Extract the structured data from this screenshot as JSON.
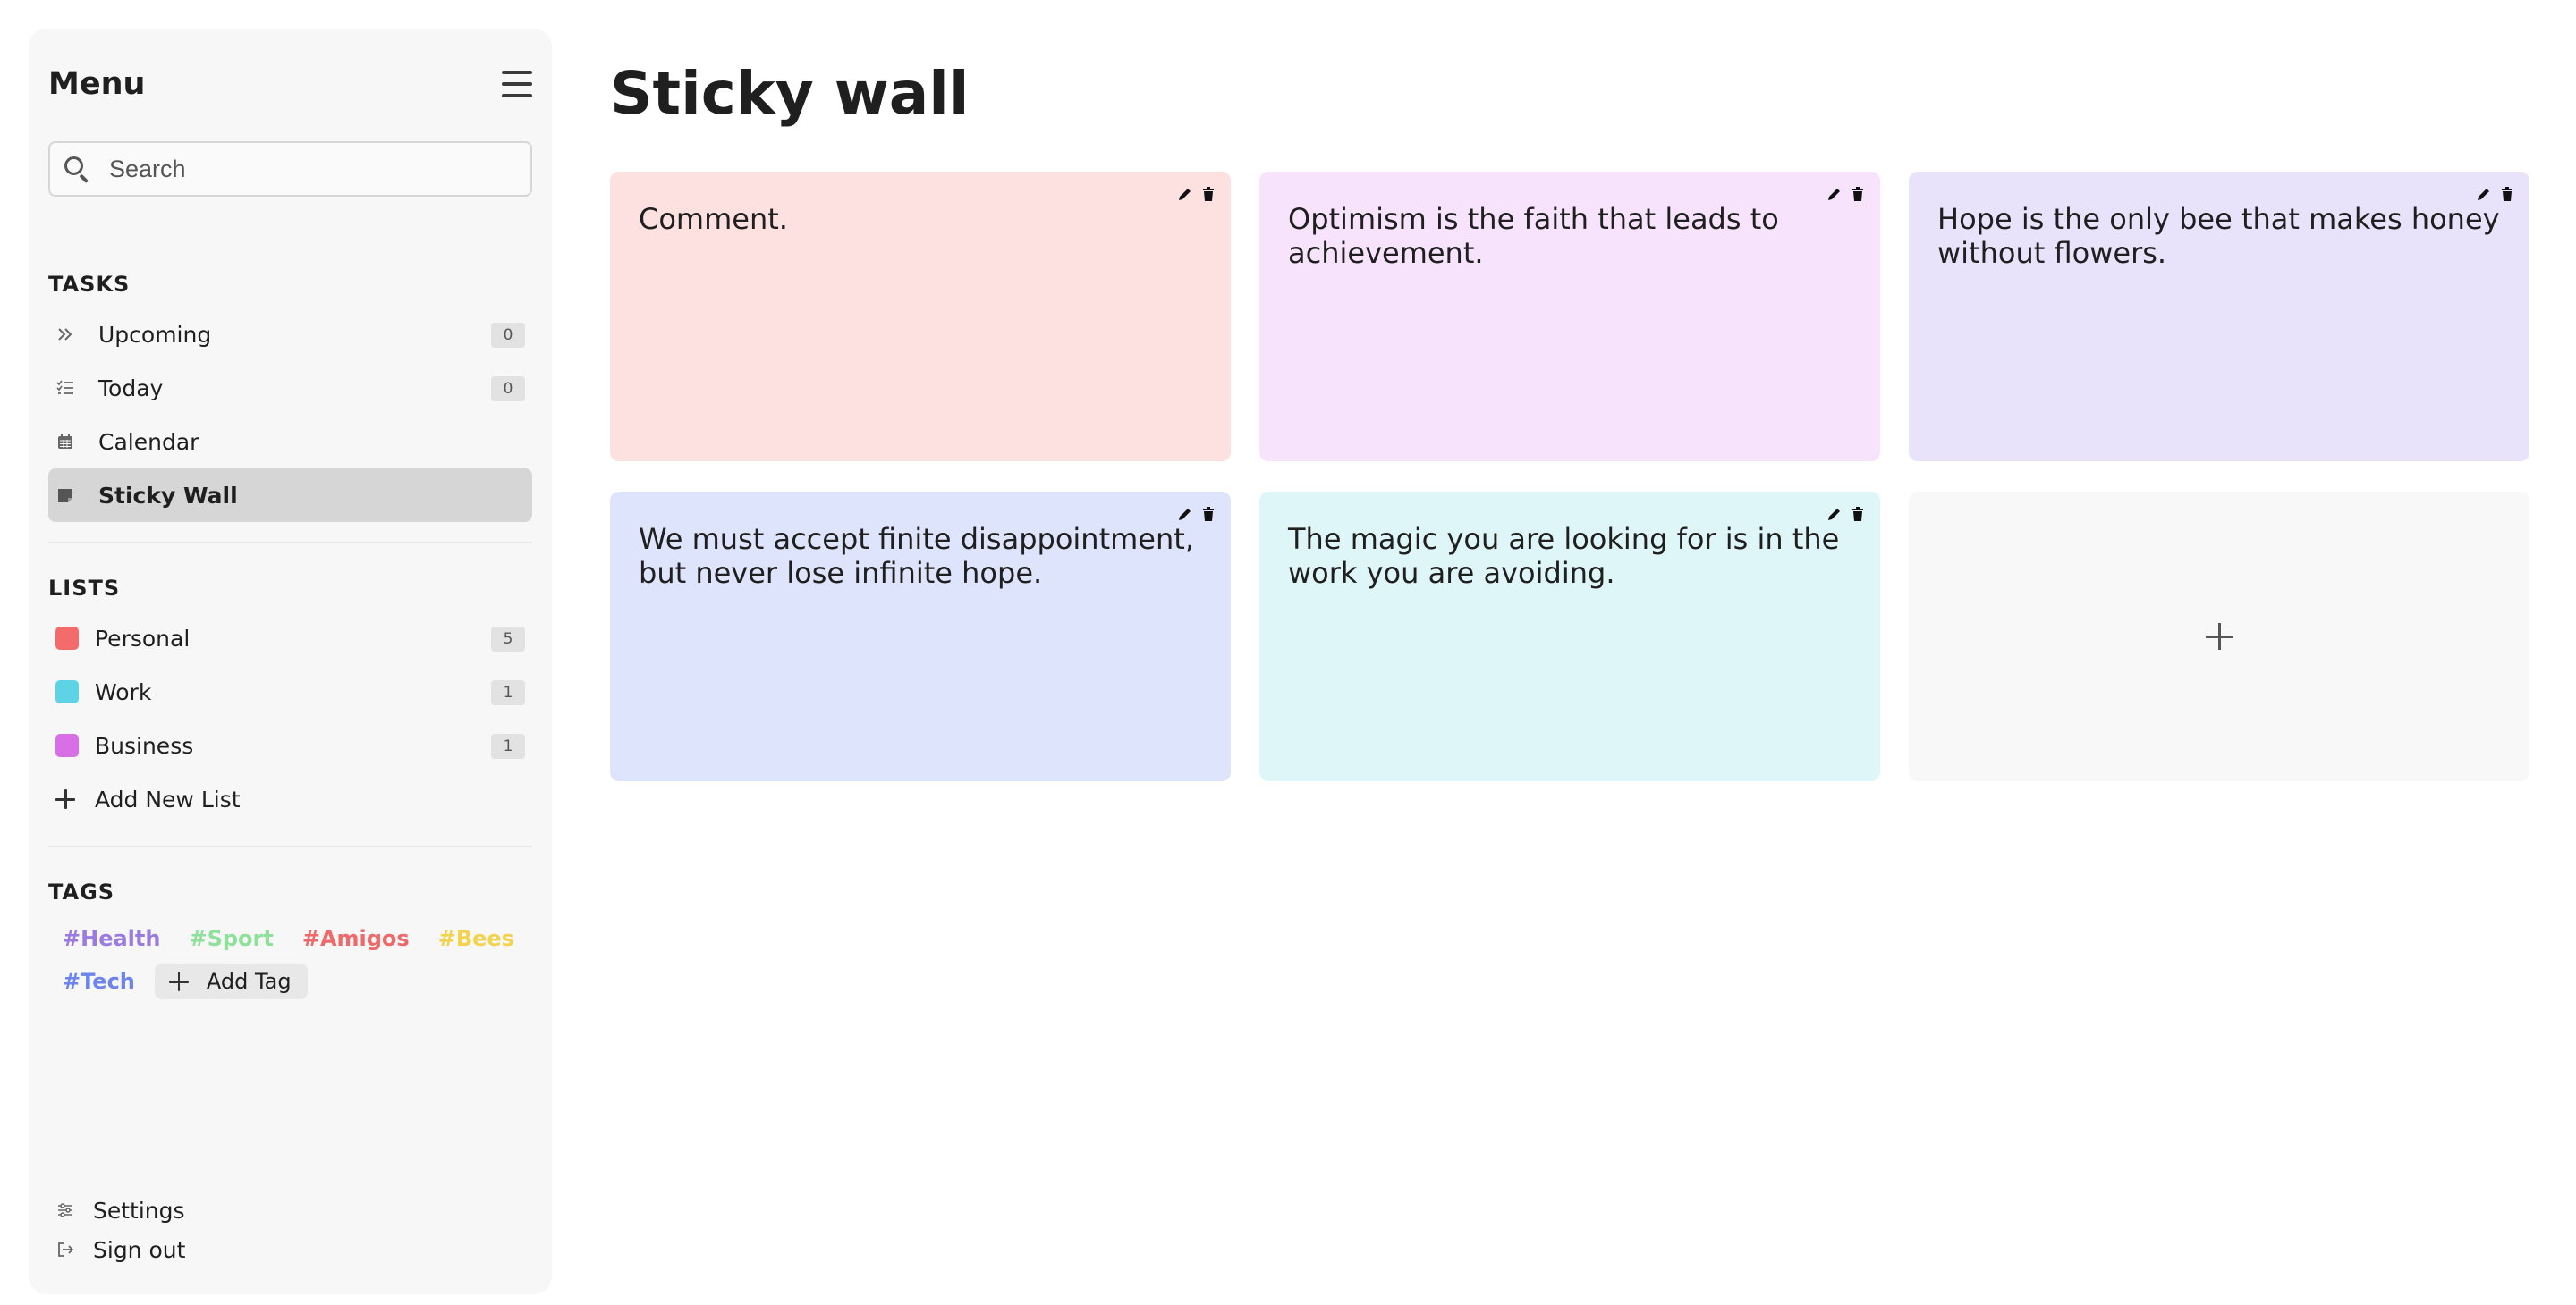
{
  "sidebar": {
    "title": "Menu",
    "search": {
      "placeholder": "Search",
      "value": ""
    },
    "tasks_label": "TASKS",
    "tasks": [
      {
        "label": "Upcoming",
        "count": "0",
        "icon": "double-chevron-right-icon"
      },
      {
        "label": "Today",
        "count": "0",
        "icon": "checklist-icon"
      },
      {
        "label": "Calendar",
        "icon": "calendar-icon"
      },
      {
        "label": "Sticky Wall",
        "icon": "sticky-note-icon",
        "active": true
      }
    ],
    "lists_label": "LISTS",
    "lists": [
      {
        "label": "Personal",
        "count": "5",
        "color": "#f36b6b"
      },
      {
        "label": "Work",
        "count": "1",
        "color": "#5fd3e6"
      },
      {
        "label": "Business",
        "count": "1",
        "color": "#d86fe6"
      }
    ],
    "add_list_label": "Add New List",
    "tags_label": "TAGS",
    "tags": [
      {
        "label": "#Health",
        "color": "#9b7be0"
      },
      {
        "label": "#Sport",
        "color": "#8ee09b"
      },
      {
        "label": "#Amigos",
        "color": "#ee6a6a"
      },
      {
        "label": "#Bees",
        "color": "#f3d34e"
      },
      {
        "label": "#Tech",
        "color": "#6d84ec"
      }
    ],
    "add_tag_label": "Add Tag",
    "settings_label": "Settings",
    "signout_label": "Sign out"
  },
  "main": {
    "title": "Sticky wall",
    "notes": [
      {
        "text": "Comment.",
        "color": "#fde0e0"
      },
      {
        "text": "Optimism is the faith that leads to achievement.",
        "color": "#f7e3fb"
      },
      {
        "text": "Hope is the only bee that makes honey without flowers.",
        "color": "#e8e2fb"
      },
      {
        "text": "We must accept finite disappointment, but never lose infinite hope.",
        "color": "#dfe4fd"
      },
      {
        "text": "The magic you are looking for is in the work you are avoiding.",
        "color": "#dff6f8"
      }
    ]
  }
}
